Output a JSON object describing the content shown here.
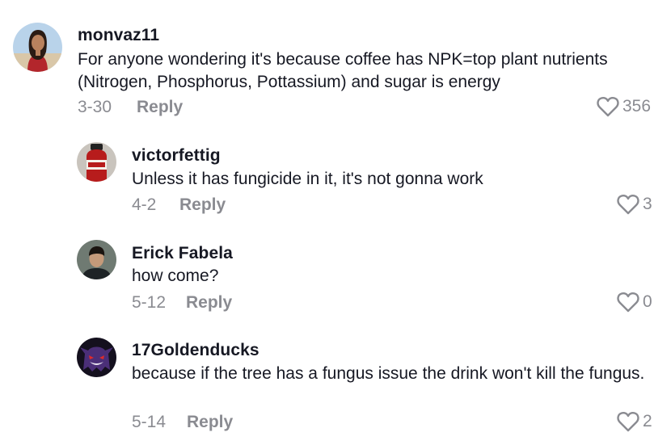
{
  "comments": [
    {
      "username": "monvaz11",
      "text": "For anyone wondering it's because coffee has NPK=top plant nutrients (Nitrogen, Phosphorus, Pottassium) and sugar is energy",
      "date": "3-30",
      "reply_label": "Reply",
      "likes": "356",
      "avatar_icon": "profile-photo-woman"
    },
    {
      "username": "victorfettig",
      "text": "Unless it has fungicide in it, it's not gonna work",
      "date": "4-2",
      "reply_label": "Reply",
      "likes": "3",
      "avatar_icon": "profile-photo-bottle"
    },
    {
      "username": "Erick Fabela",
      "text": "how come?",
      "date": "5-12",
      "reply_label": "Reply",
      "likes": "0",
      "avatar_icon": "profile-photo-man"
    },
    {
      "username": "17Goldenducks",
      "text": "because if the tree has a fungus issue the drink won't kill the fungus.",
      "date": "5-14",
      "reply_label": "Reply",
      "likes": "2",
      "avatar_icon": "profile-photo-ghost"
    }
  ],
  "colors": {
    "text_primary": "#161823",
    "text_secondary": "#8a8b91",
    "background": "#ffffff"
  },
  "icons": {
    "like": "heart-outline-icon"
  }
}
